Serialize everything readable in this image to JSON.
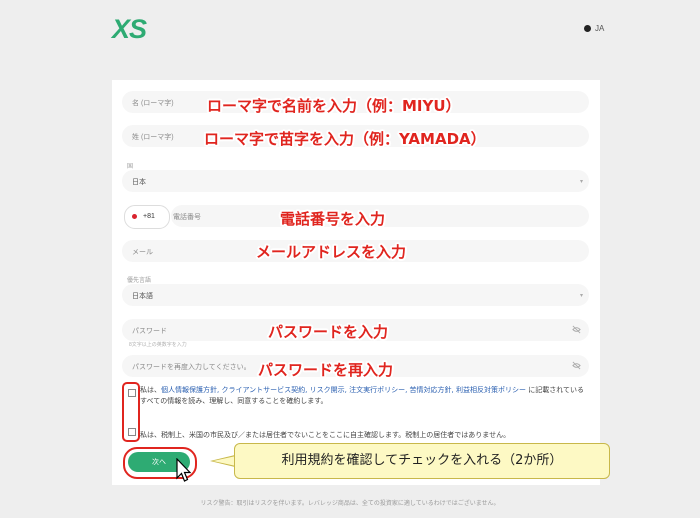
{
  "header": {
    "logo": "XS",
    "lang": "JA"
  },
  "form": {
    "first_name_placeholder": "名 (ローマ字)",
    "last_name_placeholder": "姓 (ローマ字)",
    "country_label": "国",
    "country_value": "日本",
    "phone_code": "+81",
    "phone_placeholder": "電話番号",
    "email_placeholder": "メール",
    "language_label": "優先言語",
    "language_value": "日本語",
    "password_placeholder": "パスワード",
    "password_hint": "8文字以上の英数字を入力",
    "password_confirm_placeholder": "パスワードを再度入力してください。",
    "terms1_prefix": "私は、",
    "terms1_links": "個人情報保護方針, クライアントサービス契約, リスク開示, 注文実行ポリシー, 苦情対応方針, 利益相反対策ポリシー",
    "terms1_suffix": " に記載されているすべての情報を読み、理解し、同意することを確約します。",
    "terms2": "私は、税制上、米国の市民及び／または居住者でないことをここに自主確認します。税制上の居住者ではありません。",
    "next_button": "次へ"
  },
  "annotations": {
    "first_name": "ローマ字で名前を入力（例：MIYU）",
    "last_name": "ローマ字で苗字を入力（例：YAMADA）",
    "phone": "電話番号を入力",
    "email": "メールアドレスを入力",
    "password": "パスワードを入力",
    "password_confirm": "パスワードを再入力",
    "checkbox_callout": "利用規約を確認してチェックを入れる（2か所）"
  },
  "footer": {
    "risk": "リスク警告：取引はリスクを伴います。レバレッジ商品は、全ての投資家に適しているわけではございません。"
  },
  "colors": {
    "brand": "#2eab73",
    "annotation": "#e0251f",
    "callout_bg": "#fdf9c4"
  }
}
